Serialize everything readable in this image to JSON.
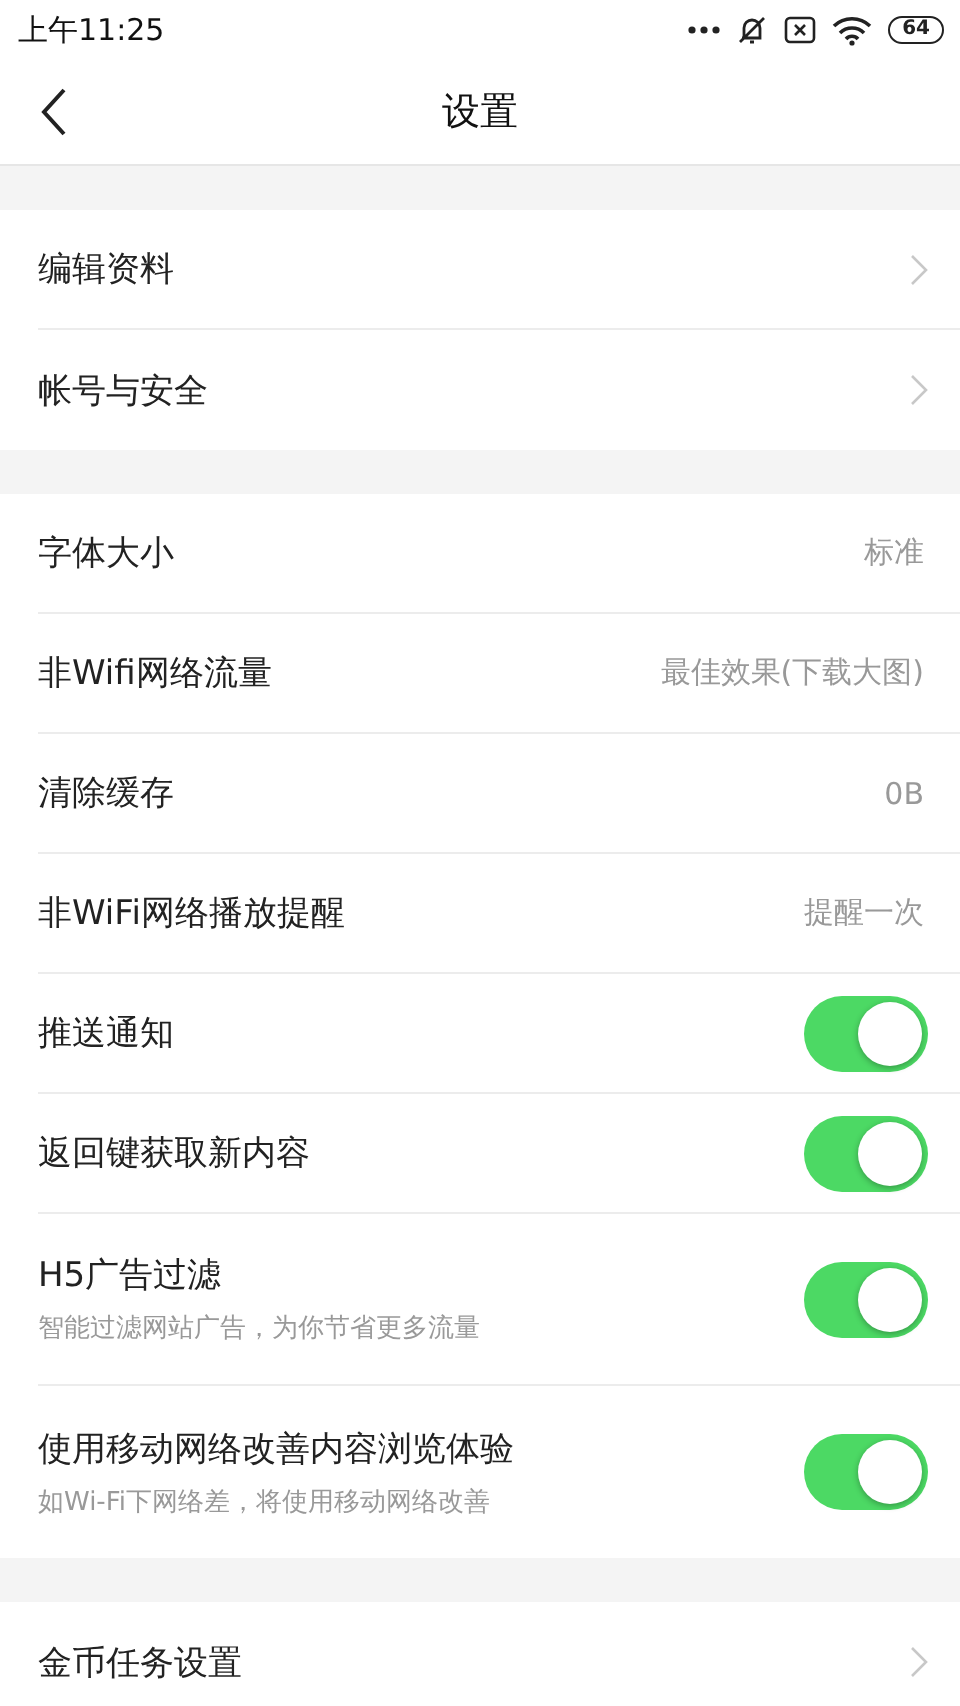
{
  "status_bar": {
    "time": "上午11:25",
    "battery": "64"
  },
  "header": {
    "title": "设置"
  },
  "sections": [
    {
      "rows": [
        {
          "kind": "link",
          "label": "编辑资料"
        },
        {
          "kind": "link",
          "label": "帐号与安全"
        }
      ]
    },
    {
      "rows": [
        {
          "kind": "value",
          "label": "字体大小",
          "value": "标准"
        },
        {
          "kind": "value",
          "label": "非Wifi网络流量",
          "value": "最佳效果(下载大图)"
        },
        {
          "kind": "value",
          "label": "清除缓存",
          "value": "0B"
        },
        {
          "kind": "value",
          "label": "非WiFi网络播放提醒",
          "value": "提醒一次"
        },
        {
          "kind": "toggle",
          "label": "推送通知",
          "on": true
        },
        {
          "kind": "toggle",
          "label": "返回键获取新内容",
          "on": true
        },
        {
          "kind": "toggle",
          "label": "H5广告过滤",
          "subtitle": "智能过滤网站广告，为你节省更多流量",
          "on": true
        },
        {
          "kind": "toggle",
          "label": "使用移动网络改善内容浏览体验",
          "subtitle": "如Wi-Fi下网络差，将使用移动网络改善",
          "on": true
        }
      ]
    },
    {
      "rows": [
        {
          "kind": "link",
          "label": "金币任务设置"
        }
      ]
    }
  ]
}
